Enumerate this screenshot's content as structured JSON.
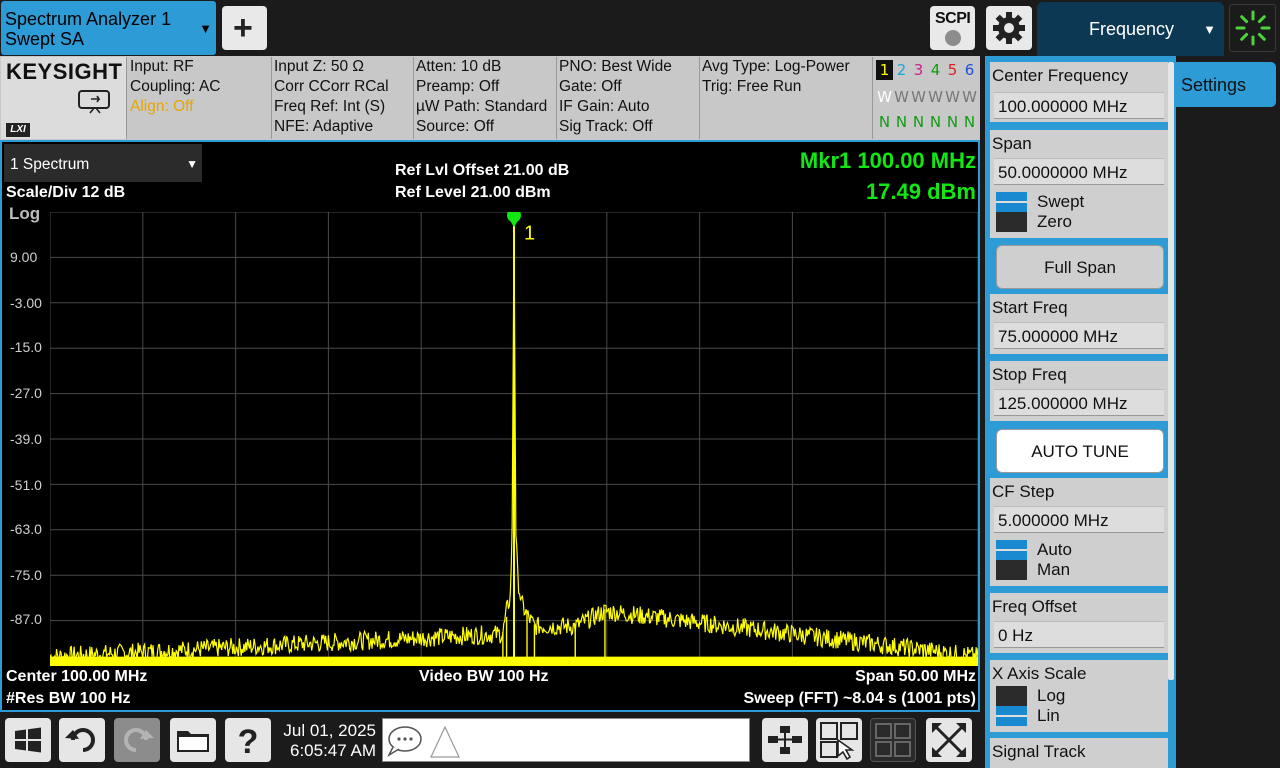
{
  "topbar": {
    "mode_line1": "Spectrum Analyzer 1",
    "mode_line2": "Swept SA",
    "add_icon": "plus-icon",
    "scpi_label": "SCPI",
    "gear_icon": "gear-icon",
    "menu_tab": "Frequency",
    "sweep_icon": "sweep-spinner-icon"
  },
  "brand": {
    "name": "KEYSIGHT",
    "lxi": "LXI",
    "remote_icon": "remote-display-icon"
  },
  "infobar": {
    "col1": [
      "Input: RF",
      "Coupling: AC",
      "Align: Off"
    ],
    "col2": [
      "Input Z: 50 Ω",
      "Corr CCorr RCal",
      "Freq Ref: Int (S)",
      "NFE: Adaptive"
    ],
    "col3": [
      "Atten: 10 dB",
      "Preamp: Off",
      "µW Path: Standard",
      "Source: Off"
    ],
    "col4": [
      "PNO: Best Wide",
      "Gate: Off",
      "IF Gain: Auto",
      "Sig Track: Off"
    ],
    "col5": [
      "Avg Type: Log-Power",
      "Trig: Free Run"
    ],
    "traces": [
      "1",
      "2",
      "3",
      "4",
      "5",
      "6"
    ],
    "trace_types": [
      "W",
      "W",
      "W",
      "W",
      "W",
      "W"
    ],
    "trace_det": [
      "N",
      "N",
      "N",
      "N",
      "N",
      "N"
    ],
    "trace_colors": [
      "#ffff00",
      "#18c6e8",
      "#e0309e",
      "#18c018",
      "#e83030",
      "#3060e8"
    ]
  },
  "display": {
    "window_tab": "1 Spectrum",
    "scale": "Scale/Div 12 dB",
    "scale_type": "Log",
    "ref_offset": "Ref Lvl Offset 21.00 dB",
    "ref_level": "Ref Level 21.00 dBm",
    "marker_freq": "Mkr1 100.00 MHz",
    "marker_amp": "17.49 dBm",
    "marker_label": "1",
    "y_ticks": [
      "9.00",
      "-3.00",
      "-15.0",
      "-27.0",
      "-39.0",
      "-51.0",
      "-63.0",
      "-75.0",
      "-87.0"
    ],
    "center": "Center 100.00 MHz",
    "res_bw": "#Res BW 100 Hz",
    "video_bw": "Video BW 100 Hz",
    "span": "Span 50.00 MHz",
    "sweep": "Sweep (FFT) ~8.04 s  (1001 pts)",
    "trace_color": "#ffff00",
    "marker_color": "#11e811"
  },
  "chart_data": {
    "type": "line",
    "x_units": "MHz",
    "y_units": "dBm",
    "xlim": [
      75,
      125
    ],
    "ylim": [
      -99,
      21
    ],
    "y_ticks": [
      9,
      -3,
      -15,
      -27,
      -39,
      -51,
      -63,
      -75,
      -87
    ],
    "grid": true,
    "noise_floor_dbm": -96,
    "series": [
      {
        "x": [
          75,
          99.4,
          99.6,
          99.8,
          99.9,
          100.0,
          100.1,
          100.2,
          100.4,
          100.7,
          101.1,
          103.3,
          104.9,
          125
        ],
        "y": [
          -96,
          -90,
          -84,
          -80,
          -63,
          17.49,
          -63,
          -75,
          -82,
          -85,
          -88,
          -88,
          -84,
          -96
        ]
      }
    ],
    "marker": {
      "label": "1",
      "x": 100.0,
      "y": 17.49
    }
  },
  "rpanel": {
    "settings_tab": "Settings",
    "center_freq": {
      "title": "Center Frequency",
      "value": "100.000000 MHz"
    },
    "span": {
      "title": "Span",
      "value": "50.0000000 MHz",
      "opt1": "Swept",
      "opt2": "Zero"
    },
    "full_span": "Full Span",
    "start_freq": {
      "title": "Start Freq",
      "value": "75.000000 MHz"
    },
    "stop_freq": {
      "title": "Stop Freq",
      "value": "125.000000 MHz"
    },
    "auto_tune": "AUTO TUNE",
    "cf_step": {
      "title": "CF Step",
      "value": "5.000000 MHz",
      "opt1": "Auto",
      "opt2": "Man"
    },
    "freq_offset": {
      "title": "Freq Offset",
      "value": "0 Hz"
    },
    "x_axis_scale": {
      "title": "X Axis Scale",
      "opt1": "Log",
      "opt2": "Lin"
    },
    "signal_track": {
      "title": "Signal Track"
    }
  },
  "taskbar": {
    "icons": [
      "windows-icon",
      "undo-icon",
      "redo-icon",
      "folder-icon",
      "help-icon"
    ],
    "date": "Jul 01, 2025",
    "time": "6:05:47 AM",
    "msg_icon": "message-icon",
    "right_icons": [
      "window-layout-icon",
      "touch-zoom-icon",
      "multi-window-icon",
      "maximize-icon"
    ]
  }
}
